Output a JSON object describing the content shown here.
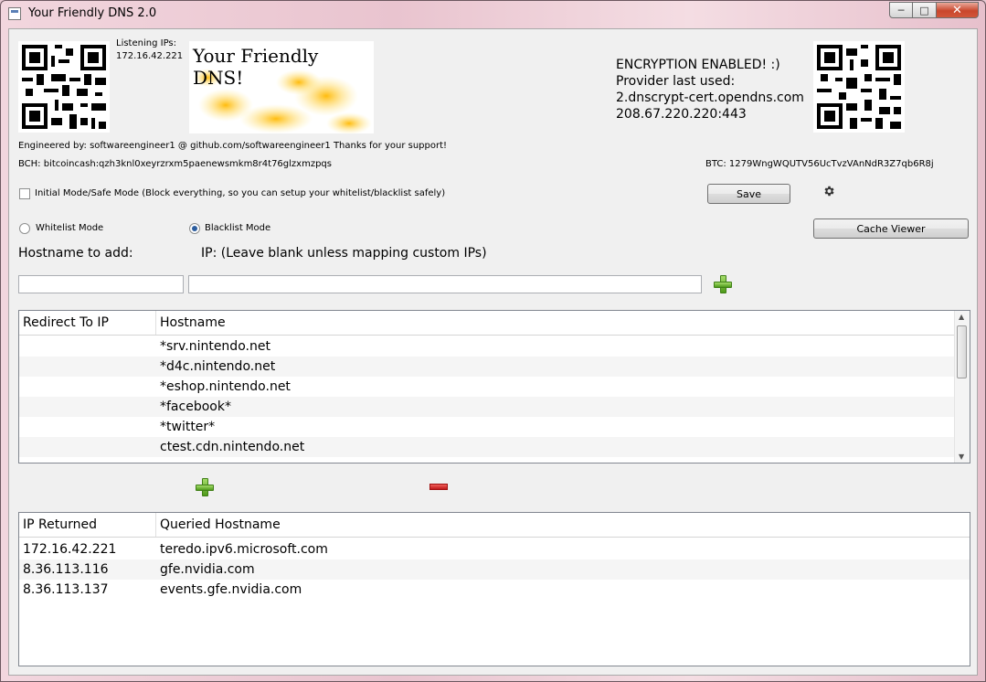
{
  "window": {
    "title": "Your Friendly DNS 2.0",
    "min_icon": "minimize-icon",
    "max_icon": "maximize-icon",
    "close_icon": "close-icon"
  },
  "header": {
    "listening_label": "Listening IPs:",
    "listening_ip": "172.16.42.221",
    "banner_title": "Your Friendly DNS!",
    "encryption": {
      "line1": "ENCRYPTION ENABLED! :)",
      "line2": "Provider last used:",
      "line3": "2.dnscrypt-cert.opendns.com",
      "line4": "208.67.220.220:443"
    },
    "engineered_by": "Engineered by: softwareengineer1 @ github.com/softwareengineer1 Thanks for your support!",
    "bch": "BCH: bitcoincash:qzh3knl0xeyrzrxm5paenewsmkm8r4t76glzxmzpqs",
    "btc": "BTC: 1279WngWQUTV56UcTvzVAnNdR3Z7qb6R8j"
  },
  "options": {
    "safe_mode_label": "Initial Mode/Safe Mode (Block everything, so you can setup your whitelist/blacklist safely)",
    "save_label": "Save",
    "whitelist_label": "Whitelist Mode",
    "blacklist_label": "Blacklist Mode",
    "cache_viewer_label": "Cache Viewer",
    "hostname_to_add_label": "Hostname to add:",
    "ip_label": "IP: (Leave blank unless mapping custom IPs)"
  },
  "list_table": {
    "columns": [
      "Redirect To IP",
      "Hostname"
    ],
    "rows": [
      [
        "",
        "*srv.nintendo.net"
      ],
      [
        "",
        "*d4c.nintendo.net"
      ],
      [
        "",
        "*eshop.nintendo.net"
      ],
      [
        "",
        "*facebook*"
      ],
      [
        "",
        "*twitter*"
      ],
      [
        "",
        "ctest.cdn.nintendo.net"
      ]
    ]
  },
  "cache_table": {
    "columns": [
      "IP Returned",
      "Queried Hostname"
    ],
    "rows": [
      [
        "172.16.42.221",
        "teredo.ipv6.microsoft.com"
      ],
      [
        "8.36.113.116",
        "gfe.nvidia.com"
      ],
      [
        "8.36.113.137",
        "events.gfe.nvidia.com"
      ]
    ]
  }
}
